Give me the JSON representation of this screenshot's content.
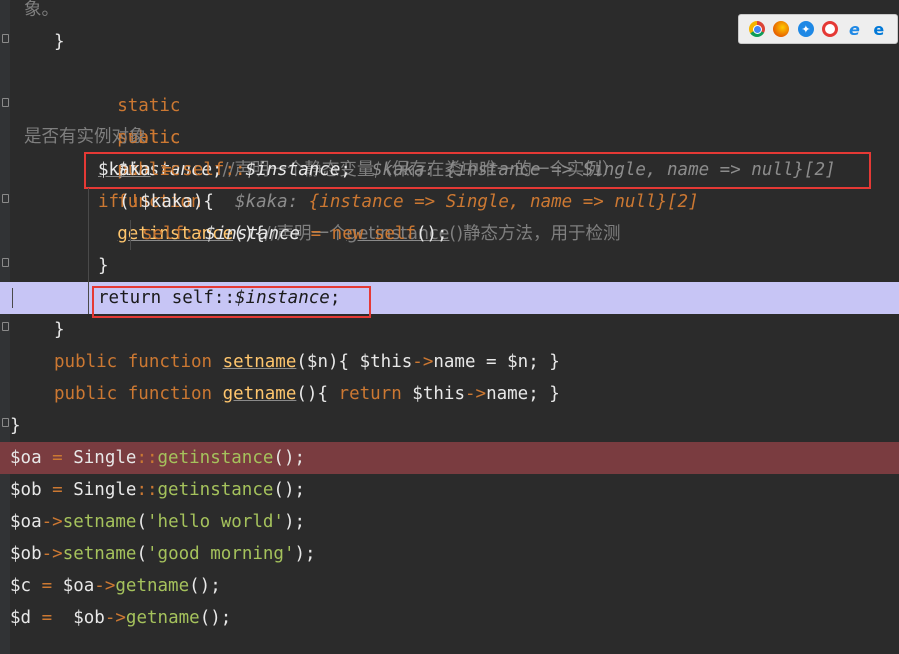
{
  "comments": {
    "top_fragment": "象。",
    "instance_decl": "//声明一个静态变量（保存在类中唯一的一个实例）",
    "getinstance_decl_a": "//声明一个",
    "getinstance_decl_fn": "getinstance",
    "getinstance_decl_b": "()静态方法，用于检测",
    "getinstance_decl_cont": "是否有实例对象"
  },
  "code": {
    "brace_close": "}",
    "static": "static",
    "public": "public",
    "function": "function",
    "instance_var": "$instance",
    "semicolon": ";",
    "getinstance": "getinstance",
    "parens_open_brace": "(){",
    "kaka_var": "$kaka",
    "assign": " = ",
    "self": "self",
    "dcolon": "::",
    "if": "if",
    "if_cond_open": "(",
    "not": "!",
    "if_cond_close": "$kaka){",
    "new": "new",
    "self_call": "self",
    "call_end": "();",
    "return": "return",
    "setname": "setname",
    "setname_params": "($n){ ",
    "this": "$this",
    "arrow": "->",
    "name_prop": "name",
    "setname_tail": " = $n; }",
    "getname": "getname",
    "getname_open": "(){ ",
    "getname_tail": "; }",
    "oa": "$oa",
    "ob": "$ob",
    "single": "Single",
    "c": "$c",
    "d": "$d",
    "d_assign": " =  ",
    "open_paren": "(",
    "close_call": ");",
    "hello": "'hello world'",
    "morning": "'good morning'"
  },
  "hints": {
    "kaka_line_label": "$kaka: ",
    "kaka_line_value": "{instance => Single, name => null}[2]",
    "if_line_label": "$kaka: ",
    "if_line_value": "{instance => Single, name => null}[2]"
  },
  "browsers": [
    "chrome-icon",
    "firefox-icon",
    "safari-icon",
    "opera-icon",
    "ie-icon",
    "edge-icon"
  ],
  "colors": {
    "background": "#2b2b2b",
    "keyword": "#cc7832",
    "function": "#ffc66d",
    "string": "#a5c25c",
    "comment": "#7f7f7f",
    "current_line": "#c7c5f5",
    "breakpoint_line": "#7a3c40",
    "annotation_box": "#e53935"
  }
}
